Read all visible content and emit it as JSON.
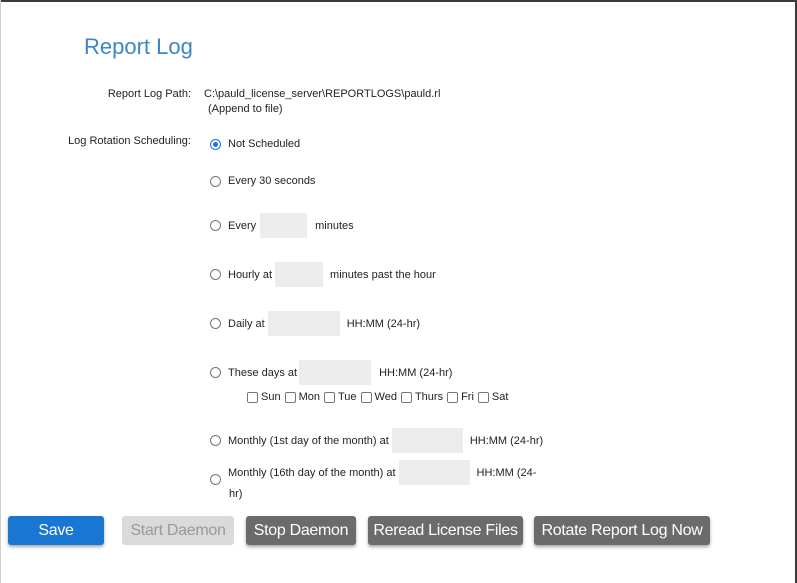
{
  "page": {
    "title": "Report Log"
  },
  "report_log_path": {
    "label": "Report Log Path:",
    "value": "C:\\pauld_license_server\\REPORTLOGS\\pauld.rl",
    "note": "(Append to file)"
  },
  "rotation": {
    "label": "Log Rotation Scheduling:",
    "selected": "not_scheduled",
    "options": {
      "not_scheduled": "Not Scheduled",
      "every_30_seconds": "Every 30 seconds",
      "every_minutes_prefix": "Every",
      "every_minutes_suffix": "minutes",
      "hourly_prefix": "Hourly at",
      "hourly_suffix": "minutes past the hour",
      "daily_prefix": "Daily at",
      "daily_suffix": "HH:MM (24-hr)",
      "these_days_prefix": "These days at",
      "these_days_suffix": "HH:MM (24-hr)",
      "monthly_1st_prefix": "Monthly (1st day of the month) at",
      "monthly_1st_suffix": "HH:MM (24-hr)",
      "monthly_16th_prefix": "Monthly (16th day of the month) at",
      "monthly_16th_suffix_line1": "HH:MM (24-",
      "monthly_16th_suffix_line2": "hr)"
    },
    "field_values": {
      "every_minutes": "",
      "hourly": "",
      "daily": "",
      "these_days": "",
      "monthly_1st": "",
      "monthly_16th": ""
    },
    "days": [
      "Sun",
      "Mon",
      "Tue",
      "Wed",
      "Thurs",
      "Fri",
      "Sat"
    ]
  },
  "buttons": {
    "save": "Save",
    "start_daemon": "Start Daemon",
    "stop_daemon": "Stop Daemon",
    "reread": "Reread License Files",
    "rotate": "Rotate Report Log Now"
  },
  "colors": {
    "title": "#3b86c8",
    "primary": "#1976d2",
    "disabled_bg": "#dadada",
    "grey_button": "#6b6b6b",
    "field_bg": "#ececec"
  }
}
